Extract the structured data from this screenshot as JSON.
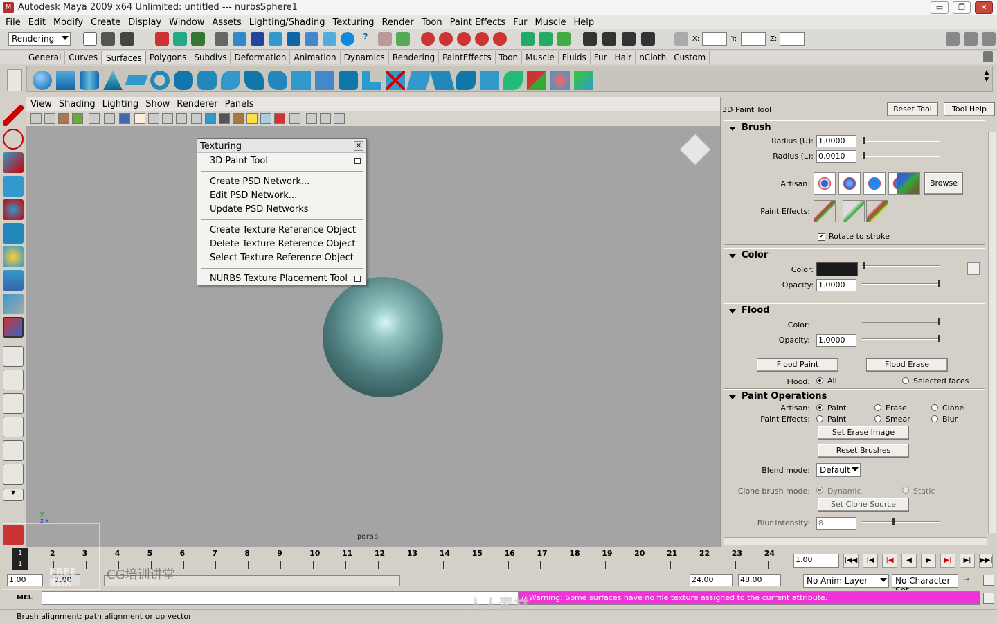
{
  "window": {
    "title": "Autodesk Maya 2009 x64 Unlimited: untitled    ---    nurbsSphere1",
    "min_label": "▭",
    "max_label": "❐",
    "close_label": "✕"
  },
  "menubar": [
    "File",
    "Edit",
    "Modify",
    "Create",
    "Display",
    "Window",
    "Assets",
    "Lighting/Shading",
    "Texturing",
    "Render",
    "Toon",
    "Paint Effects",
    "Fur",
    "Muscle",
    "Help"
  ],
  "statusline": {
    "mode": "Rendering",
    "x_label": "X:",
    "y_label": "Y:",
    "z_label": "Z:"
  },
  "shelf_tabs": [
    "General",
    "Curves",
    "Surfaces",
    "Polygons",
    "Subdivs",
    "Deformation",
    "Animation",
    "Dynamics",
    "Rendering",
    "PaintEffects",
    "Toon",
    "Muscle",
    "Fluids",
    "Fur",
    "Hair",
    "nCloth",
    "Custom"
  ],
  "shelf_active": "Surfaces",
  "viewport_menu": [
    "View",
    "Shading",
    "Lighting",
    "Show",
    "Renderer",
    "Panels"
  ],
  "viewport": {
    "camera": "persp",
    "axis_y": "y",
    "axis_zx": "z  x"
  },
  "texturing_menu": {
    "title": "Texturing",
    "items": [
      "3D Paint Tool",
      "Create PSD Network...",
      "Edit PSD Network...",
      "Update PSD Networks",
      "Create Texture Reference Object",
      "Delete Texture Reference Object",
      "Select Texture Reference Object",
      "NURBS Texture Placement Tool"
    ]
  },
  "tool_panel": {
    "title": "3D Paint Tool",
    "reset_tool": "Reset Tool",
    "tool_help": "Tool Help",
    "brush": {
      "heading": "Brush",
      "radius_u_label": "Radius (U):",
      "radius_u": "1.0000",
      "radius_l_label": "Radius (L):",
      "radius_l": "0.0010",
      "artisan_label": "Artisan:",
      "browse": "Browse",
      "paint_effects_label": "Paint Effects:",
      "rotate_to_stroke": "Rotate to stroke",
      "rotate_checked": "✔"
    },
    "color": {
      "heading": "Color",
      "color_label": "Color:",
      "opacity_label": "Opacity:",
      "opacity": "1.0000",
      "swatch": "#1a1a1a"
    },
    "flood": {
      "heading": "Flood",
      "color_label": "Color:",
      "opacity_label": "Opacity:",
      "opacity": "1.0000",
      "flood_paint": "Flood Paint",
      "flood_erase": "Flood Erase",
      "flood_label": "Flood:",
      "all": "All",
      "selected_faces": "Selected faces"
    },
    "paint_ops": {
      "heading": "Paint Operations",
      "artisan_label": "Artisan:",
      "pe_label": "Paint Effects:",
      "paint": "Paint",
      "erase": "Erase",
      "clone": "Clone",
      "smear": "Smear",
      "blur": "Blur",
      "set_erase_image": "Set Erase Image",
      "reset_brushes": "Reset Brushes",
      "blend_mode_label": "Blend mode:",
      "blend_mode": "Default",
      "clone_brush_mode_label": "Clone brush mode:",
      "dynamic": "Dynamic",
      "static": "Static",
      "set_clone_source": "Set Clone Source",
      "blur_intensity_label": "Blur intensity:",
      "blur_intensity": "8"
    }
  },
  "timeline": {
    "ticks": [
      "1",
      "2",
      "3",
      "4",
      "5",
      "6",
      "7",
      "8",
      "9",
      "10",
      "11",
      "12",
      "13",
      "14",
      "15",
      "16",
      "17",
      "18",
      "19",
      "20",
      "21",
      "22",
      "23",
      "24"
    ],
    "current_frame": "1.00",
    "current_marker": "1"
  },
  "range": {
    "start": "1.00",
    "inner_start": "1.00",
    "end": "24.00",
    "outer_end": "48.00",
    "anim_layer": "No Anim Layer",
    "char_set": "No Character Set"
  },
  "command": {
    "mel_label": "MEL",
    "warning": "// Warning: Some surfaces have no file texture assigned to the current attribute."
  },
  "help_line": "Brush alignment: path alignment or up vector",
  "watermarks": {
    "freebox": "FREE BOX",
    "cg": "CG培训讲堂",
    "site": "人人素材"
  },
  "colors": {
    "warning_bg": "#f033d8",
    "sphere": "#4c7b7b",
    "viewport_bg": "#a4a4a4"
  }
}
